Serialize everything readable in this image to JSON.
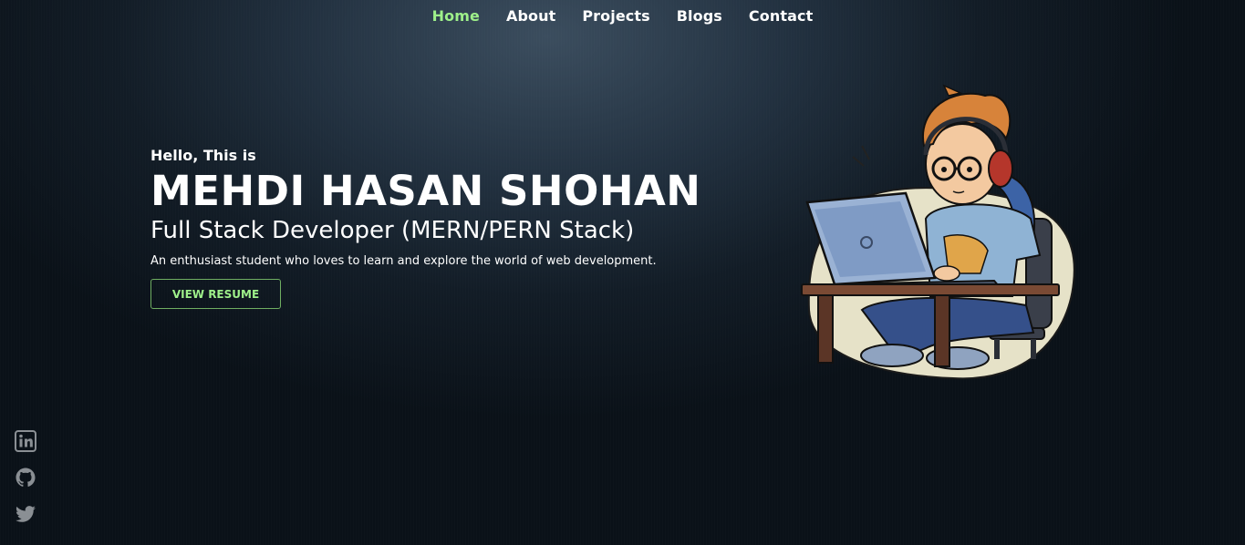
{
  "nav": {
    "items": [
      {
        "label": "Home",
        "active": true
      },
      {
        "label": "About",
        "active": false
      },
      {
        "label": "Projects",
        "active": false
      },
      {
        "label": "Blogs",
        "active": false
      },
      {
        "label": "Contact",
        "active": false
      }
    ]
  },
  "hero": {
    "greeting": "Hello, This is",
    "name": "MEHDI HASAN SHOHAN",
    "role": "Full Stack Developer (MERN/PERN Stack)",
    "tagline": "An enthusiast student who loves to learn and explore the world of web development.",
    "resume_button": "VIEW RESUME"
  },
  "illustration": {
    "subject": "developer-at-laptop-illustration"
  },
  "socials": {
    "items": [
      {
        "icon": "linkedin-icon"
      },
      {
        "icon": "github-icon"
      },
      {
        "icon": "twitter-icon"
      }
    ]
  },
  "colors": {
    "accent": "#9ef08a",
    "text": "#ffffff",
    "background": "#121c26",
    "icon": "#8a8f94"
  }
}
